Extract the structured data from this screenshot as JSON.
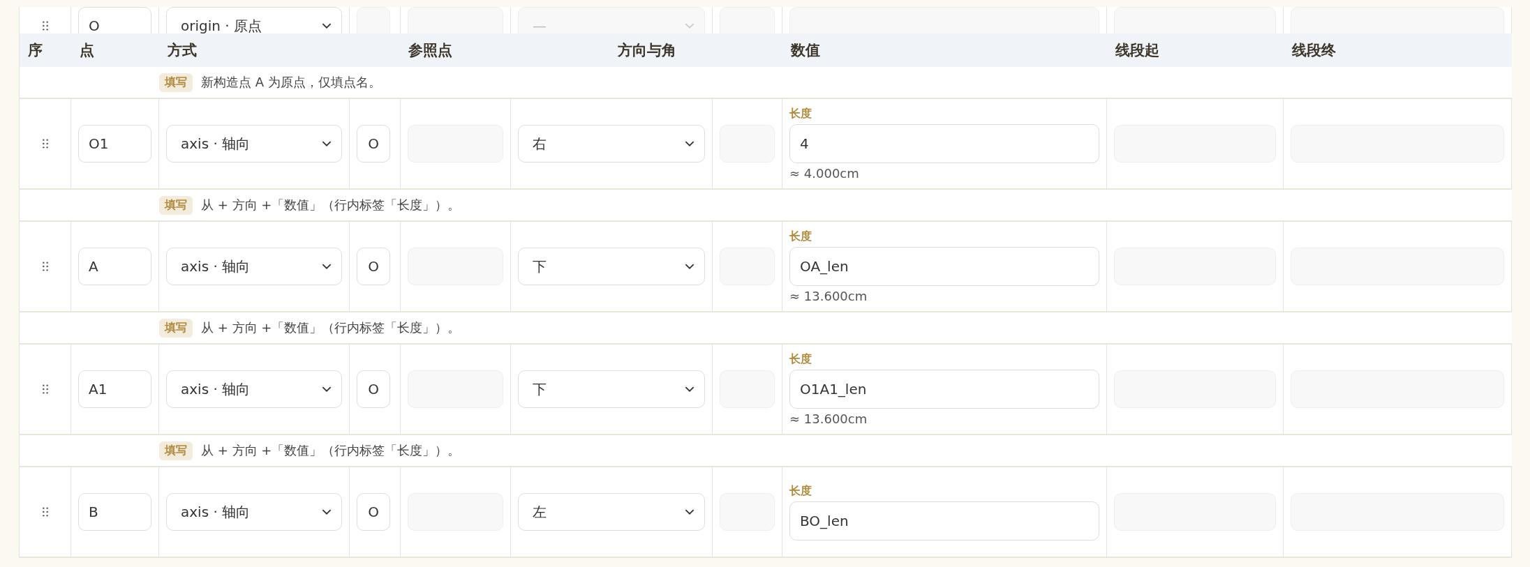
{
  "columns": [
    {
      "label": "序"
    },
    {
      "label": "点"
    },
    {
      "label": "方式"
    },
    {
      "label": "参照点"
    },
    {
      "label": "方向与角"
    },
    {
      "label": "数值"
    },
    {
      "label": "线段起"
    },
    {
      "label": "线段终"
    }
  ],
  "rows": [
    {
      "point": "O",
      "method": "origin · 原点",
      "ref_point": "",
      "direction": "—",
      "direction_disabled": true,
      "hint": {
        "tag": "填写",
        "text": "新构造点 A 为原点，仅填点名。"
      }
    },
    {
      "point": "O1",
      "method": "axis · 轴向",
      "ref_point": "O",
      "direction": "右",
      "direction_disabled": false,
      "value": {
        "label": "长度",
        "input": "4",
        "approx": "≈ 4.000cm"
      },
      "hint": {
        "tag": "填写",
        "text": "从 + 方向 +「数值」（行内标签「长度」）。"
      }
    },
    {
      "point": "A",
      "method": "axis · 轴向",
      "ref_point": "O",
      "direction": "下",
      "direction_disabled": false,
      "value": {
        "label": "长度",
        "input": "OA_len",
        "approx": "≈ 13.600cm"
      },
      "hint": {
        "tag": "填写",
        "text": "从 + 方向 +「数值」（行内标签「长度」）。"
      }
    },
    {
      "point": "A1",
      "method": "axis · 轴向",
      "ref_point": "O",
      "direction": "下",
      "direction_disabled": false,
      "value": {
        "label": "长度",
        "input": "O1A1_len",
        "approx": "≈ 13.600cm"
      },
      "hint": {
        "tag": "填写",
        "text": "从 + 方向 +「数值」（行内标签「长度」）。"
      }
    },
    {
      "point": "B",
      "method": "axis · 轴向",
      "ref_point": "O",
      "direction": "左",
      "direction_disabled": false,
      "value": {
        "label": "长度",
        "input": "BO_len"
      }
    }
  ]
}
